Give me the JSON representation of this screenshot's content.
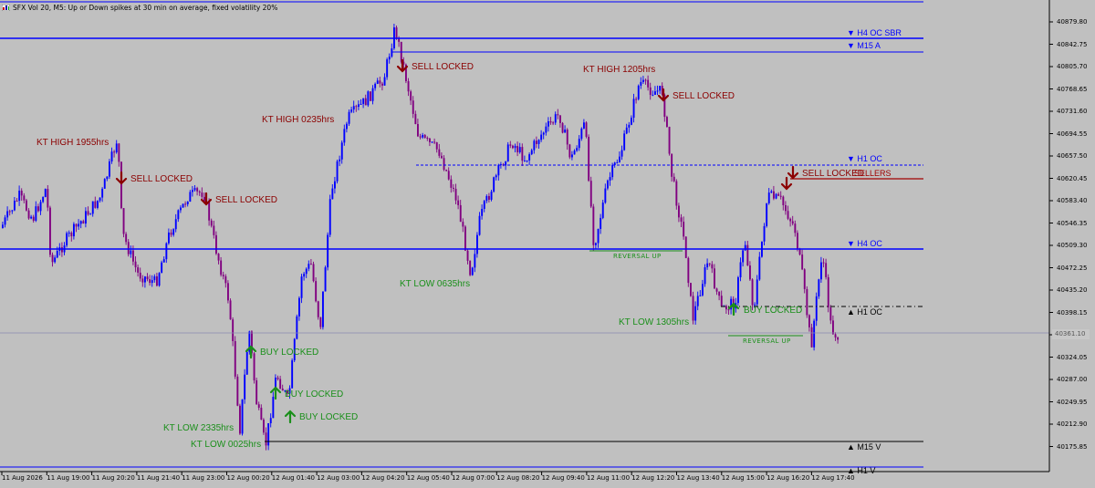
{
  "window": {
    "title": "SFX Vol 20, M5:  Up or Down spikes at 30 min on average, fixed volatility 20%"
  },
  "colors": {
    "background": "#c0c0c0",
    "bull": "#0000ff",
    "bear": "#800080",
    "level_line": "#0000ff",
    "sell_text": "#8b0000",
    "buy_text": "#1a8f1a",
    "red_line": "#a00000"
  },
  "price_axis": {
    "ticks": [
      "40879.80",
      "40842.75",
      "40805.70",
      "40768.65",
      "40731.60",
      "40694.55",
      "40657.50",
      "40620.45",
      "40583.40",
      "40546.35",
      "40509.30",
      "40472.25",
      "40435.20",
      "40398.15",
      "40361.10",
      "40324.05",
      "40287.00",
      "40249.95",
      "40212.90",
      "40175.85"
    ],
    "current_price": "40361.10"
  },
  "time_axis": {
    "ticks": [
      "11 Aug 2026",
      "11 Aug 19:00",
      "11 Aug 20:20",
      "11 Aug 21:40",
      "11 Aug 23:00",
      "12 Aug 00:20",
      "12 Aug 01:40",
      "12 Aug 03:00",
      "12 Aug 04:20",
      "12 Aug 05:40",
      "12 Aug 07:00",
      "12 Aug 08:20",
      "12 Aug 09:40",
      "12 Aug 11:00",
      "12 Aug 12:20",
      "12 Aug 13:40",
      "12 Aug 15:00",
      "12 Aug 16:20",
      "12 Aug 17:40"
    ]
  },
  "levels": {
    "h4_oc_sbr": "▼ H4 OC SBR",
    "m15_a": "▼ M15 A",
    "h1_oc_top": "▼ H1 OC",
    "h4_oc": "▼ H4 OC",
    "h1_oc_bottom": "▲ H1 OC",
    "m15_v": "▲ M15 V",
    "h1_v": "▲ H1 V",
    "sellers": "SELLERS"
  },
  "annotations": {
    "kt_high_1955": "KT HIGH 1955hrs",
    "kt_high_0235": "KT HIGH 0235hrs",
    "kt_high_1205": "KT HIGH 1205hrs",
    "kt_low_2335": "KT LOW 2335hrs",
    "kt_low_0025": "KT LOW 0025hrs",
    "kt_low_0635": "KT LOW 0635hrs",
    "kt_low_1305": "KT LOW 1305hrs",
    "sell_locked": "SELL LOCKED",
    "buy_locked": "BUY LOCKED",
    "reversal_up": "REVERSAL  UP"
  }
}
